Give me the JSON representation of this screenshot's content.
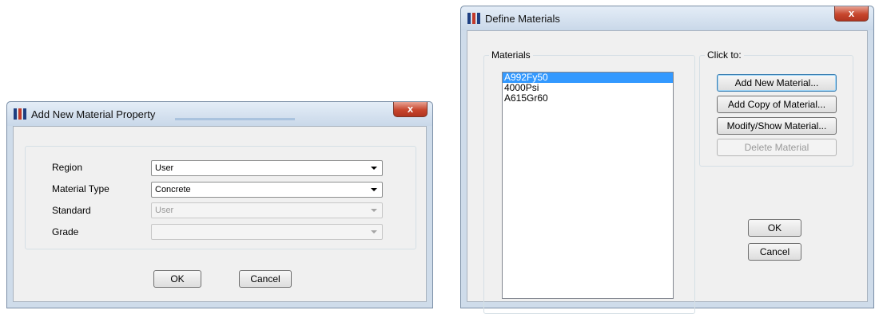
{
  "add_dialog": {
    "title": "Add New Material Property",
    "close_label": "x",
    "fields": [
      {
        "label": "Region",
        "value": "User",
        "enabled": true
      },
      {
        "label": "Material Type",
        "value": "Concrete",
        "enabled": true
      },
      {
        "label": "Standard",
        "value": "User",
        "enabled": false
      },
      {
        "label": "Grade",
        "value": "",
        "enabled": false
      }
    ],
    "ok_label": "OK",
    "cancel_label": "Cancel"
  },
  "define_dialog": {
    "title": "Define Materials",
    "close_label": "x",
    "materials_group_label": "Materials",
    "materials": [
      "A992Fy50",
      "4000Psi",
      "A615Gr60"
    ],
    "selected_material": "A992Fy50",
    "click_group_label": "Click to:",
    "buttons": {
      "add_new": "Add New Material...",
      "add_copy": "Add Copy of Material...",
      "modify": "Modify/Show Material...",
      "delete": "Delete Material"
    },
    "ok_label": "OK",
    "cancel_label": "Cancel"
  },
  "colors": {
    "selection": "#3399ff",
    "close_button": "#c7462d",
    "titlebar": "#cfdcea"
  }
}
